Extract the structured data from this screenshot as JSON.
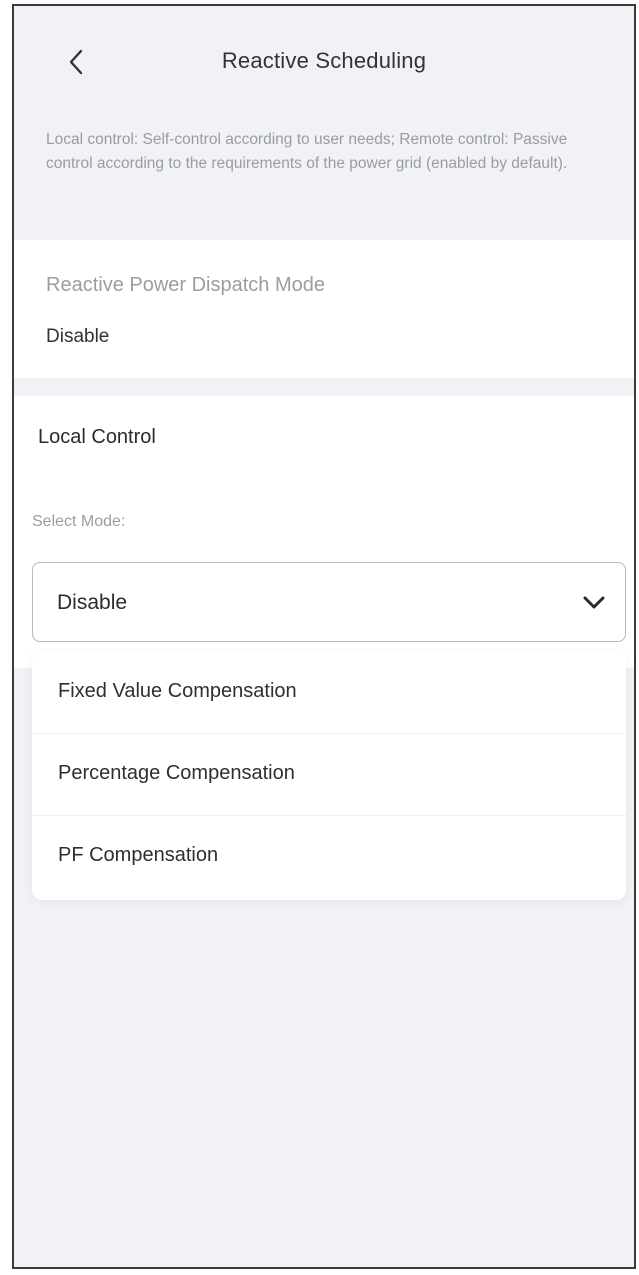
{
  "header": {
    "title": "Reactive Scheduling",
    "back_icon": "chevron-left-icon"
  },
  "info": {
    "text": "Local control: Self-control according to user needs; Remote control: Passive control according to the requirements of the power grid (enabled by default)."
  },
  "dispatch": {
    "label": "Reactive Power Dispatch Mode",
    "value": "Disable"
  },
  "local_control": {
    "title": "Local Control",
    "select_label": "Select Mode:",
    "selected_value": "Disable",
    "dropdown_icon": "chevron-down-icon",
    "options": [
      {
        "label": "Fixed Value Compensation"
      },
      {
        "label": "Percentage Compensation"
      },
      {
        "label": "PF Compensation"
      }
    ]
  },
  "colors": {
    "background": "#f1f2f6",
    "card": "#ffffff",
    "muted_text": "#9b9da5",
    "primary_text": "#2b2b2b"
  }
}
